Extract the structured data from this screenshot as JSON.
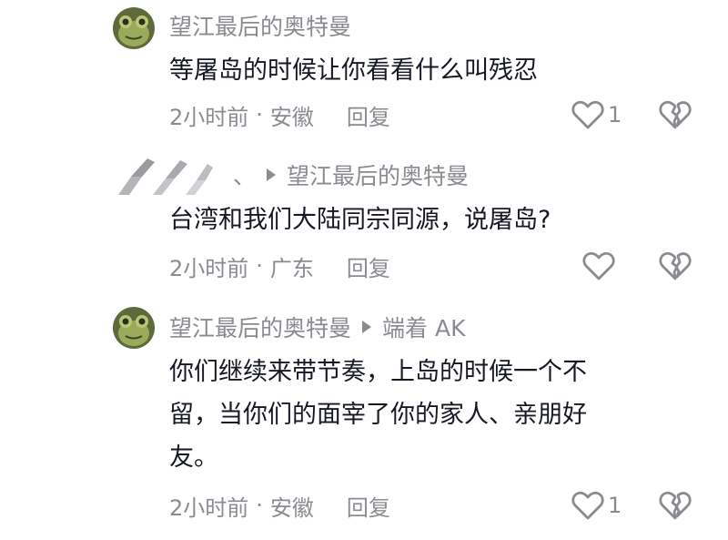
{
  "comments": [
    {
      "username": "望江最后的奥特曼",
      "content": "等屠岛的时候让你看看什么叫残忍",
      "time": "2小时前",
      "separator": "·",
      "location": "安徽",
      "reply_label": "回复",
      "like_count": "1",
      "avatar_icon": "frog-avatar-icon"
    },
    {
      "reply_to": "望江最后的奥特曼",
      "username_visible": "、",
      "content": "台湾和我们大陆同宗同源，说屠岛?",
      "time": "2小时前",
      "separator": "·",
      "location": "广东",
      "reply_label": "回复",
      "like_count": "",
      "avatar_icon": "blurred-avatar-icon"
    },
    {
      "username": "望江最后的奥特曼",
      "reply_to": "端着 AK",
      "content_lines": [
        "你们继续来带节奏，上岛的时候一个不",
        "留，当你们的面宰了你的家人、亲朋好",
        "友。"
      ],
      "time": "2小时前",
      "separator": "·",
      "location": "安徽",
      "reply_label": "回复",
      "like_count": "1",
      "avatar_icon": "frog-avatar-icon"
    }
  ],
  "colors": {
    "text_primary": "#161823",
    "text_secondary": "#8a8b91",
    "icon_stroke": "#8a8b91",
    "background": "#ffffff"
  }
}
